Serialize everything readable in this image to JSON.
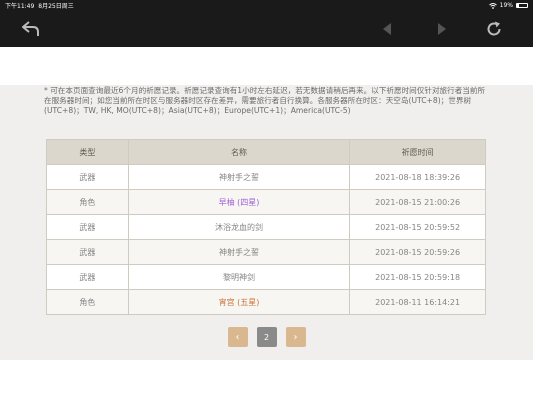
{
  "status_bar": {
    "time": "下午11:49",
    "date": "8月25日周三",
    "battery": "19%"
  },
  "toolbar": {
    "icons": [
      "back-icon",
      "prev-arrow-icon",
      "next-arrow-icon",
      "reload-icon"
    ]
  },
  "notice_text": "* 可在本页面查询最近6个月的祈愿记录。祈愿记录查询有1小时左右延迟，若无数据请稍后再来。以下祈愿时间仅针对旅行者当前所在服务器时间；如您当前所在时区与服务器时区存在差异，需要旅行者自行换算。各服务器所在时区：天空岛(UTC+8)；世界树(UTC+8)；TW, HK, MO(UTC+8)；Asia(UTC+8)；Europe(UTC+1)；America(UTC-5)",
  "table": {
    "headers": [
      "类型",
      "名称",
      "祈愿时间"
    ],
    "rows": [
      {
        "type": "武器",
        "name": "神射手之誓",
        "time": "2021-08-18 18:39:26",
        "color": "#858585"
      },
      {
        "type": "角色",
        "name": "早柚 (四星)",
        "time": "2021-08-15 21:00:26",
        "color": "#a160d6"
      },
      {
        "type": "武器",
        "name": "沐浴龙血的剑",
        "time": "2021-08-15 20:59:52",
        "color": "#858585"
      },
      {
        "type": "武器",
        "name": "神射手之誓",
        "time": "2021-08-15 20:59:26",
        "color": "#858585"
      },
      {
        "type": "武器",
        "name": "黎明神剑",
        "time": "2021-08-15 20:59:18",
        "color": "#858585"
      },
      {
        "type": "角色",
        "name": "宵宫 (五星)",
        "time": "2021-08-11 16:14:21",
        "color": "#c9743a"
      }
    ]
  },
  "pagination": {
    "prev": "‹",
    "current": "2",
    "next": "›"
  },
  "colors": {
    "header_bg": "#dcd7cc",
    "pager_arrow": "#d9b88f",
    "four_star": "#a160d6",
    "five_star": "#c9743a"
  }
}
